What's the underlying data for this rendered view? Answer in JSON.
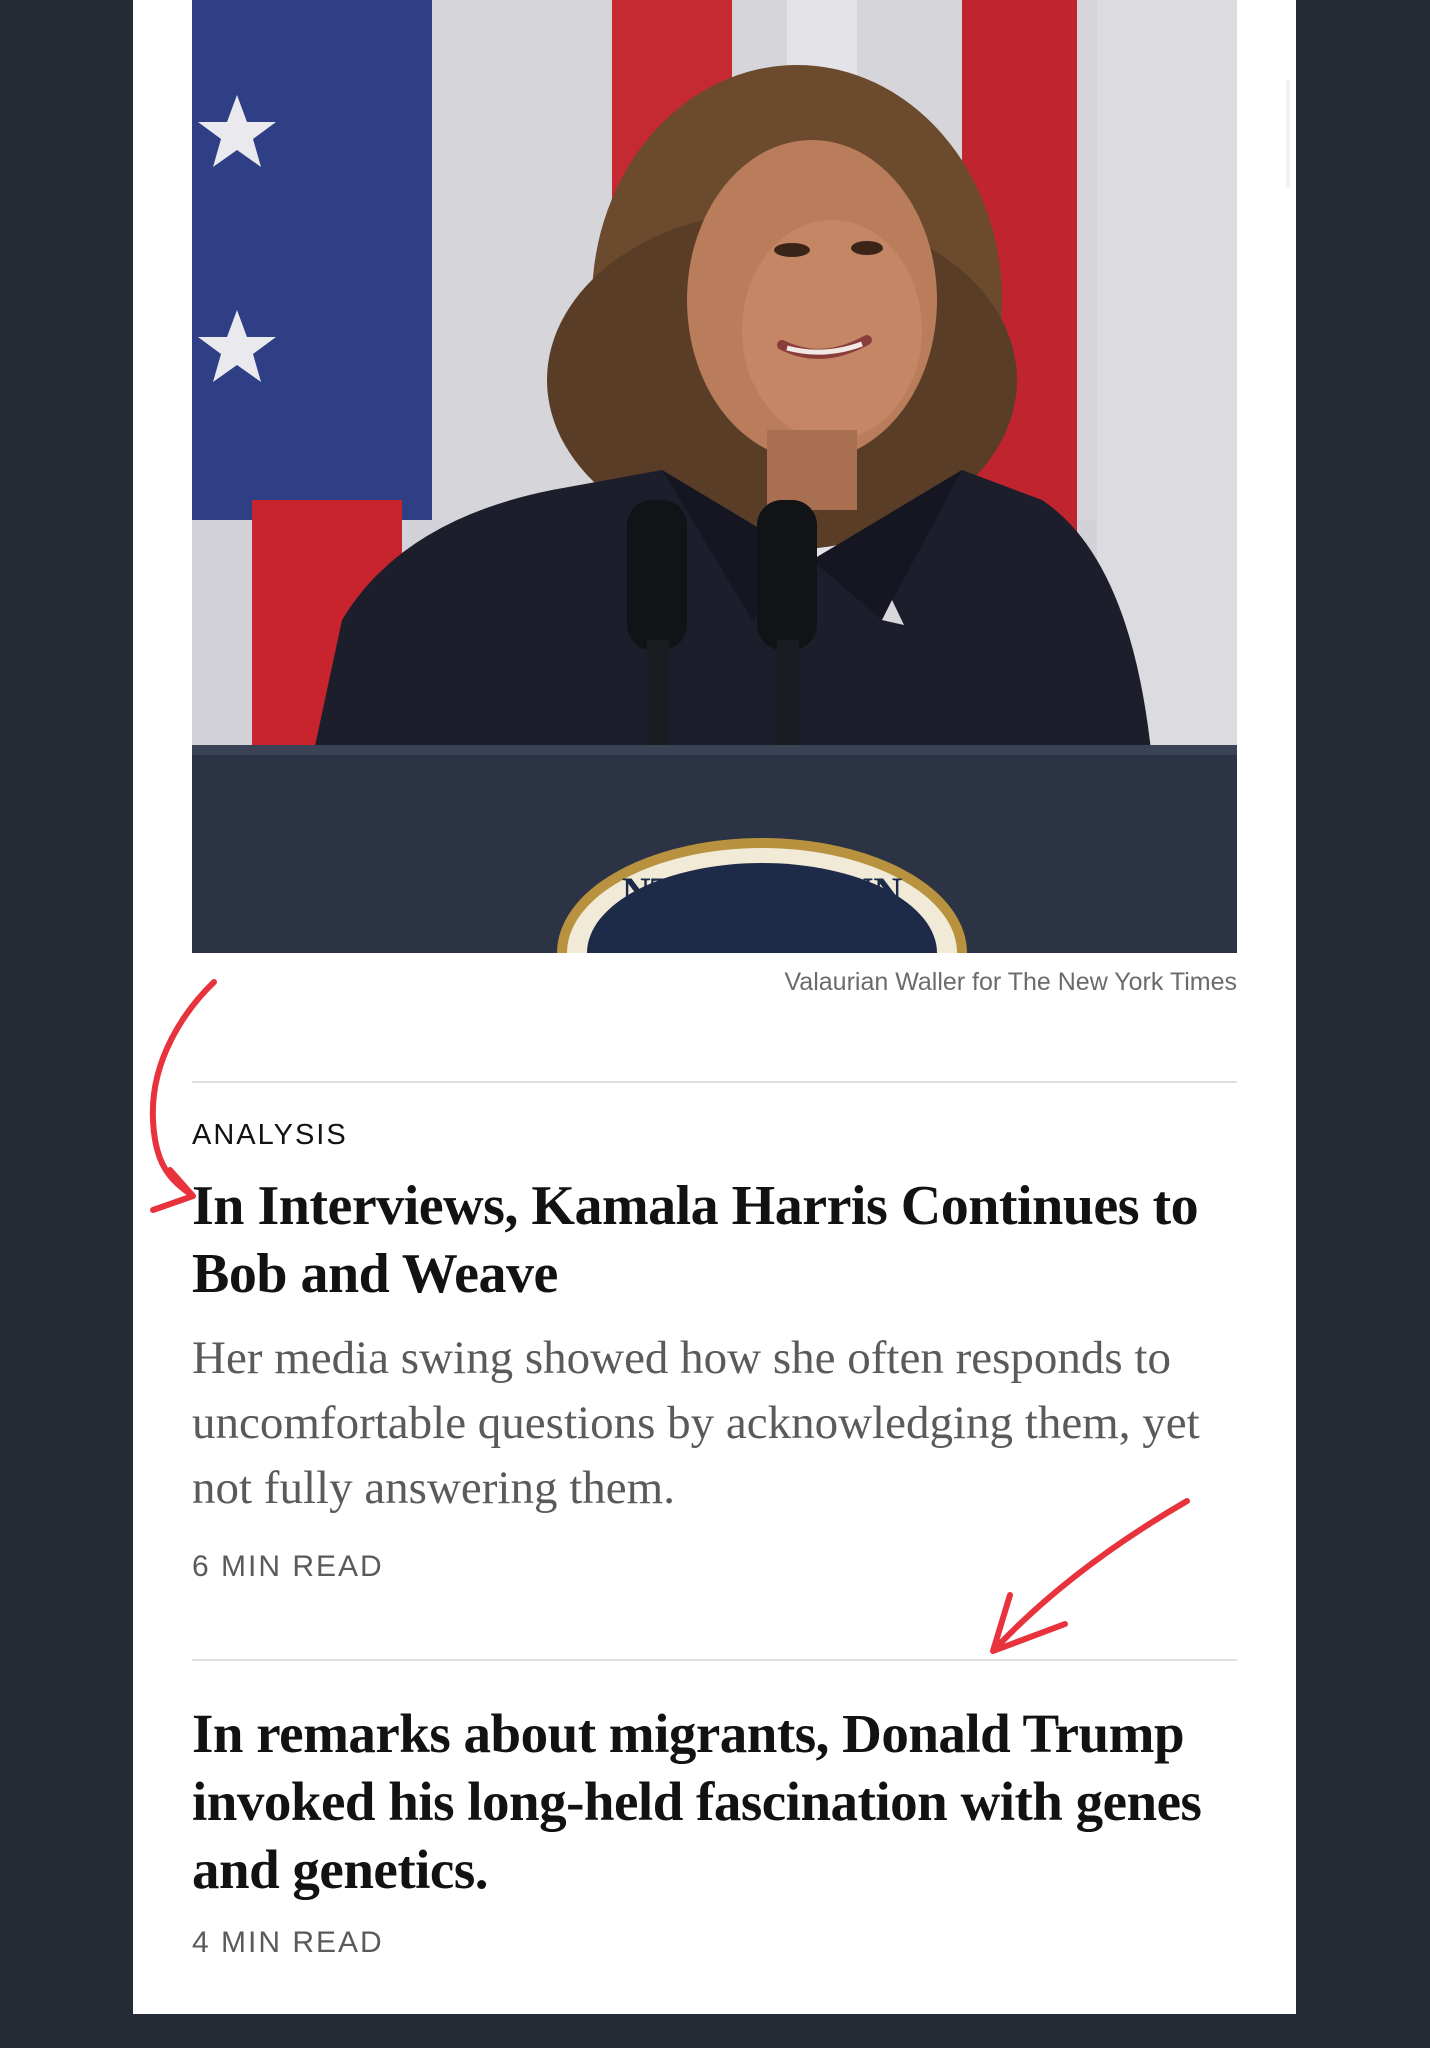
{
  "hero": {
    "image_alt": "Kamala Harris smiling at a podium with microphones, American flag behind her",
    "podium_seal_text": "NT OF THE UN",
    "credit": "Valaurian Waller for The New York Times"
  },
  "articles": [
    {
      "kicker": "ANALYSIS",
      "headline": "In Interviews, Kamala Harris Continues to Bob and Weave",
      "summary": "Her media swing showed how she often responds to uncomfortable questions by acknowledging them, yet not fully answering them.",
      "read_time": "6 MIN READ"
    },
    {
      "headline": "In remarks about migrants, Donald Trump invoked his long-held fascination with genes and genetics.",
      "read_time": "4 MIN READ"
    }
  ],
  "colors": {
    "annotation_red": "#e8323c",
    "frame_background": "#262c35"
  }
}
